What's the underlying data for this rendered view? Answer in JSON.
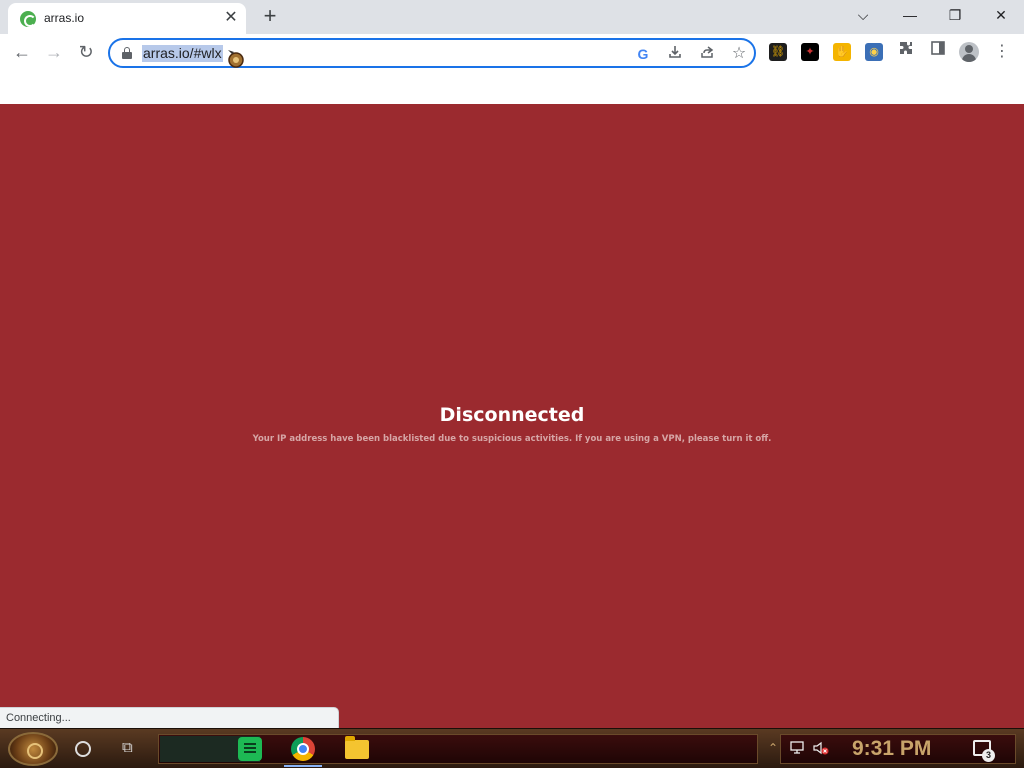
{
  "browser": {
    "tab": {
      "title": "arras.io",
      "close_glyph": "✕"
    },
    "new_tab_glyph": "+",
    "window_controls": {
      "tab_search": "⌵",
      "minimize": "—",
      "restore": "❐",
      "close": "✕"
    },
    "toolbar": {
      "back": "←",
      "forward": "→",
      "reload": "↻",
      "url": "arras.io/#wlx",
      "menu": "⋮"
    },
    "omnibox_icons": [
      "google-lens-icon",
      "install-icon",
      "share-icon",
      "bookmark-star-icon"
    ],
    "extensions": [
      "link-extension-icon",
      "dark-extension-icon",
      "hand-extension-icon",
      "globe-extension-icon",
      "puzzle-icon",
      "side-panel-icon",
      "profile-icon"
    ],
    "colors": {
      "omnibox_border": "#1a73e8",
      "url_highlight": "#b7c9ea"
    }
  },
  "page": {
    "background_color": "#9b2a2f",
    "title": "Disconnected",
    "message": "Your IP address have been blacklisted due to suspicious activities. If you are using a VPN, please turn it off."
  },
  "status_bar": {
    "text": "Connecting..."
  },
  "taskbar": {
    "apps": [
      "notes-app-icon",
      "chrome-icon",
      "file-explorer-icon"
    ],
    "clock": "9:31 PM",
    "notification_count": "3"
  }
}
